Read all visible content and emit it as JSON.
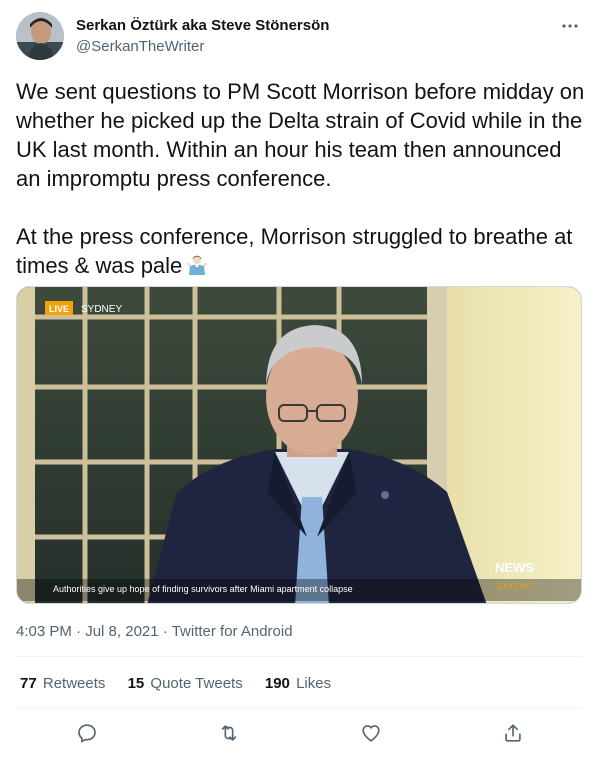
{
  "author": {
    "display_name": "Serkan Öztürk aka Steve Stönersön",
    "handle": "@SerkanTheWriter"
  },
  "tweet": {
    "paragraph_1": "We sent questions to PM Scott Morrison before midday on whether he picked up the Delta strain of Covid while in the UK last month. Within an hour his team then announced an impromptu press conference.",
    "paragraph_2": "At the press conference, Morrison struggled to breathe at times & was pale",
    "emoji": "man-shrugging-emoji"
  },
  "media": {
    "live_label": "LIVE",
    "location_label": "SYDNEY",
    "ticker_text": "Authorities give up hope of finding survivors after Miami apartment collapse",
    "network_label": "NEWS",
    "time_label": "13:42 VIC"
  },
  "meta": {
    "time": "4:03 PM",
    "date": "Jul 8, 2021",
    "source": "Twitter for Android",
    "separator": "·"
  },
  "stats": {
    "retweets_count": "77",
    "retweets_label": "Retweets",
    "quotes_count": "15",
    "quotes_label": "Quote Tweets",
    "likes_count": "190",
    "likes_label": "Likes"
  },
  "icons": {
    "more": "more-icon",
    "reply": "reply-icon",
    "retweet": "retweet-icon",
    "like": "like-icon",
    "share": "share-icon"
  },
  "colors": {
    "text_primary": "#0f1419",
    "text_secondary": "#536471",
    "divider": "#eff3f4",
    "live_badge": "#f2a20a"
  }
}
